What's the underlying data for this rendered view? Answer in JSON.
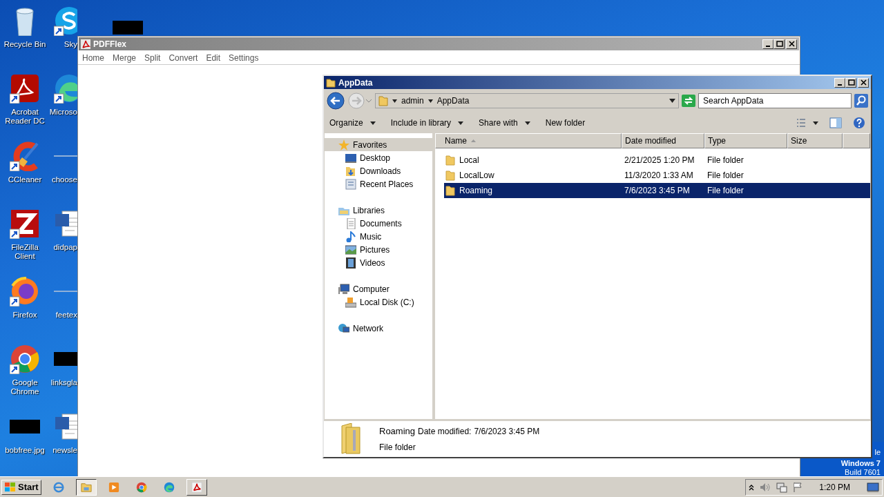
{
  "desktop_columns": [
    {
      "icons": [
        {
          "kind": "recycle",
          "label": "Recycle Bin",
          "shortcut": false
        },
        {
          "kind": "pdf",
          "label": "Acrobat Reader DC",
          "shortcut": true
        },
        {
          "kind": "cleaner",
          "label": "CCleaner",
          "shortcut": true
        },
        {
          "kind": "ftp",
          "label": "FileZilla Client",
          "shortcut": true
        },
        {
          "kind": "firefox",
          "label": "Firefox",
          "shortcut": true
        },
        {
          "kind": "chrome",
          "label": "Google Chrome",
          "shortcut": true
        },
        {
          "kind": "redacted",
          "label": "bobfree.jpg",
          "shortcut": false
        }
      ]
    },
    {
      "icons": [
        {
          "kind": "skype",
          "label": "Sky",
          "shortcut": true
        },
        {
          "kind": "edge",
          "label": "Microso",
          "shortcut": true
        },
        {
          "kind": "blank",
          "label": "choose",
          "shortcut": false
        },
        {
          "kind": "word",
          "label": "didpap",
          "shortcut": false
        },
        {
          "kind": "blank",
          "label": "feetex",
          "shortcut": false
        },
        {
          "kind": "redacted",
          "label": "linksgla",
          "shortcut": false
        },
        {
          "kind": "word",
          "label": "newsle",
          "shortcut": false
        }
      ]
    },
    {
      "icons": [
        {
          "kind": "redacted",
          "shortcut": false
        }
      ]
    }
  ],
  "os_badge": [
    "le",
    "Windows 7",
    "Build 7601"
  ],
  "pdfflex": {
    "title": "PDFFlex",
    "menu": [
      "Home",
      "Merge",
      "Split",
      "Convert",
      "Edit",
      "Settings"
    ]
  },
  "explorer": {
    "title": "AppData",
    "breadcrumbs": [
      "admin",
      "AppData"
    ],
    "search": {
      "placeholder": "Search AppData"
    },
    "toolbar": [
      {
        "label": "Organize",
        "dropdown": true
      },
      {
        "label": "Include in library",
        "dropdown": true
      },
      {
        "label": "Share with",
        "dropdown": true
      },
      {
        "label": "New folder",
        "dropdown": false
      }
    ],
    "nav": [
      {
        "kind": "favorites",
        "label": "Favorites",
        "selected": true,
        "children": [
          {
            "kind": "desktop",
            "label": "Desktop",
            "selected": false
          },
          {
            "kind": "downloads",
            "label": "Downloads",
            "selected": false
          },
          {
            "kind": "recent",
            "label": "Recent Places",
            "selected": false
          }
        ]
      },
      {
        "kind": "libraries",
        "label": "Libraries",
        "selected": false,
        "children": [
          {
            "kind": "documents",
            "label": "Documents",
            "selected": false
          },
          {
            "kind": "music",
            "label": "Music",
            "selected": false
          },
          {
            "kind": "pictures",
            "label": "Pictures",
            "selected": false
          },
          {
            "kind": "videos",
            "label": "Videos",
            "selected": false
          }
        ]
      },
      {
        "kind": "computer",
        "label": "Computer",
        "selected": false,
        "children": [
          {
            "kind": "disk",
            "label": "Local Disk (C:)",
            "selected": false
          }
        ]
      },
      {
        "kind": "network",
        "label": "Network",
        "selected": false
      }
    ],
    "columns": [
      "Name",
      "Date modified",
      "Type",
      "Size"
    ],
    "files": [
      {
        "name": "Local",
        "date": "2/21/2025 1:20 PM",
        "type": "File folder",
        "selected": false
      },
      {
        "name": "LocalLow",
        "date": "11/3/2020 1:33 AM",
        "type": "File folder",
        "selected": false
      },
      {
        "name": "Roaming",
        "date": "7/6/2023 3:45 PM",
        "type": "File folder",
        "selected": true
      }
    ],
    "details": {
      "name": "Roaming",
      "date_label": "Date modified:",
      "date": "7/6/2023 3:45 PM",
      "type": "File folder"
    }
  },
  "taskbar": {
    "start": "Start",
    "items": [
      {
        "kind": "ie",
        "open": false,
        "selected": false
      },
      {
        "kind": "explorer",
        "open": true,
        "selected": true
      },
      {
        "kind": "media",
        "open": false,
        "selected": false
      },
      {
        "kind": "chrome",
        "open": false,
        "selected": false
      },
      {
        "kind": "edge",
        "open": false,
        "selected": false
      },
      {
        "kind": "pdf",
        "open": true,
        "selected": false
      }
    ],
    "clock": "1:20 PM"
  }
}
